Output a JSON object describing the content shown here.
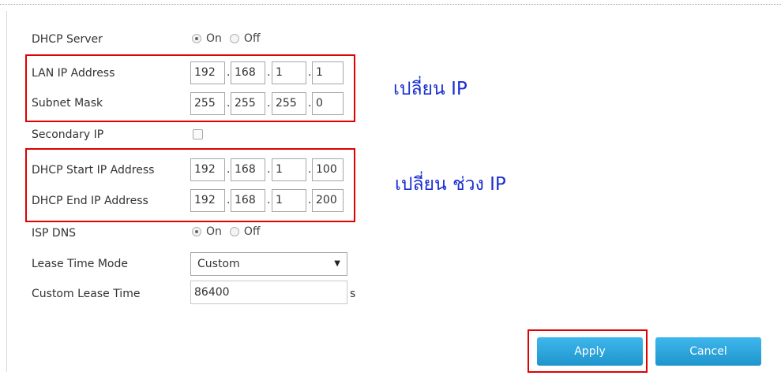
{
  "dhcp_server": {
    "label": "DHCP Server",
    "on": "On",
    "off": "Off",
    "selected": "On"
  },
  "lan_ip": {
    "label": "LAN IP Address",
    "octets": [
      "192",
      "168",
      "1",
      "1"
    ]
  },
  "subnet_mask": {
    "label": "Subnet Mask",
    "octets": [
      "255",
      "255",
      "255",
      "0"
    ]
  },
  "secondary_ip": {
    "label": "Secondary IP",
    "checked": false
  },
  "dhcp_start": {
    "label": "DHCP Start IP Address",
    "octets": [
      "192",
      "168",
      "1",
      "100"
    ]
  },
  "dhcp_end": {
    "label": "DHCP End IP Address",
    "octets": [
      "192",
      "168",
      "1",
      "200"
    ]
  },
  "isp_dns": {
    "label": "ISP DNS",
    "on": "On",
    "off": "Off",
    "selected": "On"
  },
  "lease_mode": {
    "label": "Lease Time Mode",
    "value": "Custom"
  },
  "custom_lease": {
    "label": "Custom Lease Time",
    "value": "86400",
    "unit": "s"
  },
  "annotations": {
    "change_ip": "เปลี่ยน IP",
    "change_range": "เปลี่ยน ช่วง IP"
  },
  "buttons": {
    "apply": "Apply",
    "cancel": "Cancel"
  },
  "colors": {
    "highlight": "#e00000",
    "annotation": "#1a2fd1",
    "button": "#2aa6de"
  }
}
